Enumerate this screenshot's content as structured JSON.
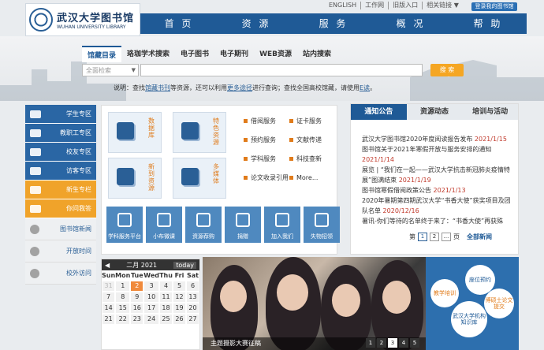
{
  "logo": {
    "cn": "武汉大学图书馆",
    "en": "WUHAN UNIVERSITY LIBRARY"
  },
  "toplinks": [
    "ENGLISH",
    "工作网",
    "旧版入口",
    "相关链接 ▼"
  ],
  "my_library": "登录我的图书馆",
  "nav": [
    "首 页",
    "资 源",
    "服 务",
    "概 况",
    "帮 助"
  ],
  "search": {
    "tabs": [
      "馆藏目录",
      "珞珈学术搜索",
      "电子图书",
      "电子期刊",
      "WEB资源",
      "站内搜索"
    ],
    "select_value": "全面检索",
    "input_value": "",
    "button": "搜 索",
    "hint_parts": [
      "说明：查找",
      "馆藏书刊",
      "等资源，还可以利用",
      "更多途径",
      "进行查询；查找全国高校馆藏，请使用",
      "E读",
      "。"
    ]
  },
  "sidebar": [
    {
      "label": "学生专区",
      "style": "blue"
    },
    {
      "label": "教职工专区",
      "style": "blue"
    },
    {
      "label": "校友专区",
      "style": "blue"
    },
    {
      "label": "访客专区",
      "style": "blue"
    },
    {
      "label": "新生专栏",
      "style": "orange"
    },
    {
      "label": "你问我答",
      "style": "orange"
    },
    {
      "label": "图书馆新闻",
      "style": "grey"
    },
    {
      "label": "开放时间",
      "style": "grey"
    },
    {
      "label": "校外访问",
      "style": "grey"
    }
  ],
  "resources": [
    "数据库",
    "特色资源",
    "新到资源",
    "多媒体"
  ],
  "services": [
    "借阅服务",
    "证卡服务",
    "预约服务",
    "文献传递",
    "学科服务",
    "科技查新",
    "论文收录引用",
    "More..."
  ],
  "icon_tiles": [
    "学科服务平台",
    "小布微课",
    "资源荐购",
    "捐赠",
    "加入我们",
    "失物招领"
  ],
  "news": {
    "tabs": [
      "通知公告",
      "资源动态",
      "培训与活动"
    ],
    "items": [
      {
        "text": "武汉大学图书馆2020年度阅读报告发布",
        "date": "2021/1/15"
      },
      {
        "text": "图书馆关于2021年寒假开放与服务安排的通知",
        "date": "2021/1/14"
      },
      {
        "text": "展览 | “我们在一起——武汉大学抗击新冠肺炎疫情特展”图满结束",
        "date": "2021/1/19"
      },
      {
        "text": "图书馆寒假借阅政策公告",
        "date": "2021/1/13"
      },
      {
        "text": "2020年暑期第四期武汉大学“书香大使”获奖项目及团队名单",
        "date": "2020/12/16"
      },
      {
        "text": "暑讯-你们等待的名单终于来了：“书香大使”再获殊",
        "date": ""
      }
    ],
    "pager_prefix": "第",
    "pages": [
      "1",
      "2",
      "..."
    ],
    "pager_suffix": "页",
    "all_news": "全部新闻"
  },
  "calendar": {
    "title": "二月 2021",
    "today": "today",
    "weekdays": [
      "Sun",
      "Mon",
      "Tue",
      "Wed",
      "Thu",
      "Fri",
      "Sat"
    ],
    "days": [
      "31",
      "1",
      "2",
      "3",
      "4",
      "5",
      "6",
      "7",
      "8",
      "9",
      "10",
      "11",
      "12",
      "13",
      "14",
      "15",
      "16",
      "17",
      "18",
      "19",
      "20",
      "21",
      "22",
      "23",
      "24",
      "25",
      "26",
      "27"
    ],
    "highlight": "2"
  },
  "banner": {
    "caption": "主题摄影大赛征稿",
    "dots": [
      "1",
      "2",
      "3",
      "4",
      "5"
    ],
    "active": "3"
  },
  "promo": [
    "座位预约",
    "教学培训",
    "博硕士论文提交",
    "武汉大学机构知识库"
  ]
}
